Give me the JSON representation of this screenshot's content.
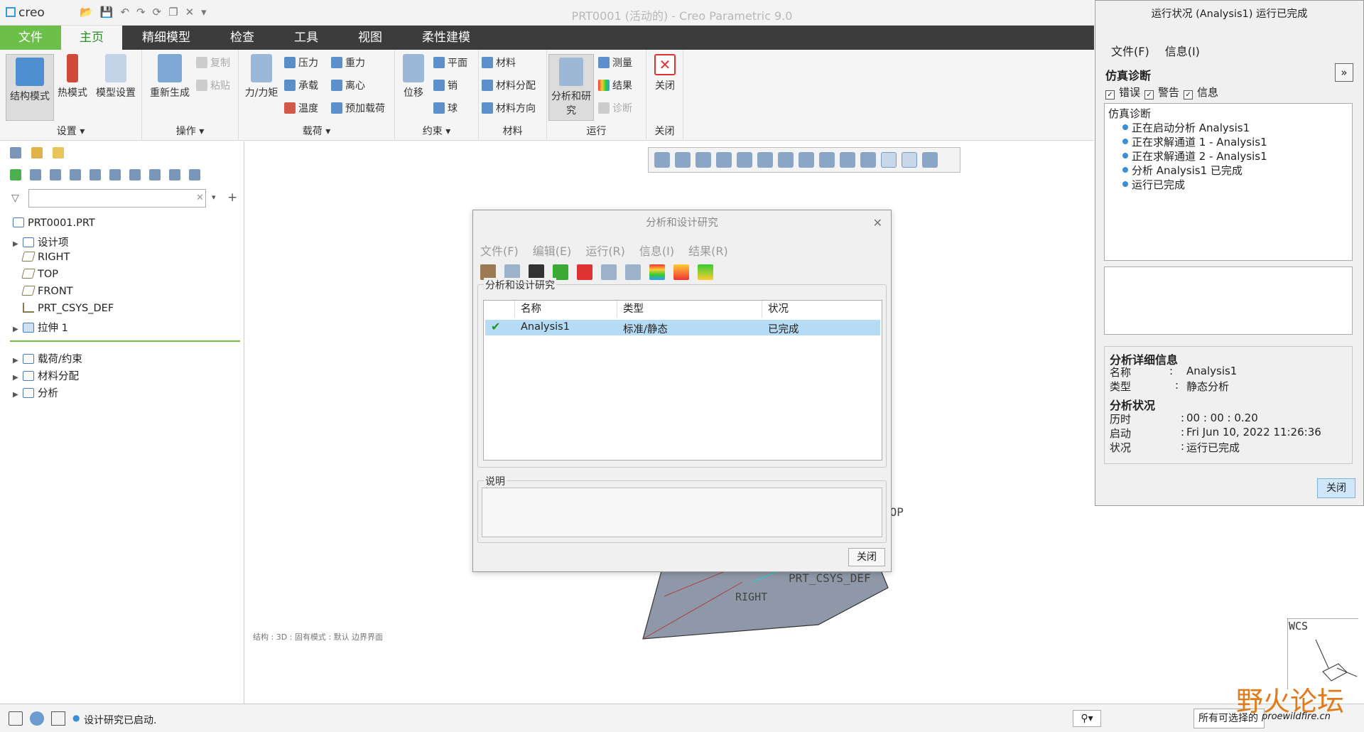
{
  "app": {
    "logo": "creo",
    "title": "PRT0001 (活动的) - Creo Parametric 9.0",
    "menu_tabs": [
      "文件",
      "主页",
      "精细模型",
      "检查",
      "工具",
      "视图",
      "柔性建模"
    ]
  },
  "ribbon": {
    "groups": [
      {
        "label": "设置",
        "buttons": [
          "结构模式",
          "热模式",
          "模型设置"
        ]
      },
      {
        "label": "操作",
        "buttons": [
          "重新生成",
          "复制",
          "粘贴"
        ]
      },
      {
        "label": "载荷",
        "buttons": [
          "力/力矩",
          "压力",
          "承载",
          "温度",
          "重力",
          "离心",
          "预加载荷"
        ]
      },
      {
        "label": "约束",
        "buttons": [
          "位移",
          "平面",
          "销",
          "球"
        ]
      },
      {
        "label": "材料",
        "buttons": [
          "材料",
          "材料分配",
          "材料方向"
        ]
      },
      {
        "label": "运行",
        "buttons": [
          "分析和研究",
          "测量",
          "结果",
          "诊断"
        ]
      },
      {
        "label": "关闭",
        "buttons": [
          "关闭"
        ]
      }
    ]
  },
  "model_tree": {
    "items": [
      "PRT0001.PRT",
      "设计项",
      "RIGHT",
      "TOP",
      "FRONT",
      "PRT_CSYS_DEF",
      "拉伸 1",
      "载荷/约束",
      "材料分配",
      "分析"
    ]
  },
  "canvas": {
    "labels": [
      "TOP",
      "PRT_CSYS_DEF",
      "RIGHT",
      "WCS"
    ],
    "status_info": "结构  :  3D  :  固有模式  :  默认  边界界面"
  },
  "analysis_dialog": {
    "title": "分析和设计研究",
    "menu": [
      "文件(F)",
      "编辑(E)",
      "运行(R)",
      "信息(I)",
      "结果(R)"
    ],
    "section_label": "分析和设计研究",
    "columns": [
      "名称",
      "类型",
      "状况"
    ],
    "rows": [
      {
        "name": "Analysis1",
        "type": "标准/静态",
        "status": "已完成"
      }
    ],
    "desc_label": "说明",
    "close_label": "关闭"
  },
  "run_status": {
    "title": "运行状况 (Analysis1) 运行已完成",
    "menu": [
      "文件(F)",
      "信息(I)"
    ],
    "diag_header": "仿真诊断",
    "checks": [
      "错误",
      "警告",
      "信息"
    ],
    "log_root": "仿真诊断",
    "log": [
      "正在启动分析 Analysis1",
      "正在求解通道 1 - Analysis1",
      "正在求解通道 2 - Analysis1",
      "分析 Analysis1 已完成",
      "运行已完成"
    ],
    "detail_header": "分析详细信息",
    "name_key": "名称",
    "name_val": "Analysis1",
    "type_key": "类型",
    "type_val": "静态分析",
    "status_header": "分析状况",
    "elapsed_key": "历时",
    "elapsed_val": "00 : 00 : 0.20",
    "start_key": "启动",
    "start_val": "Fri Jun 10, 2022   11:26:36",
    "state_key": "状况",
    "state_val": "运行已完成",
    "close_label": "关闭"
  },
  "statusbar": {
    "message": "设计研究已启动.",
    "selection": "所有可选择的"
  },
  "watermark": {
    "text": "野火论坛",
    "url": "proewildfire.cn"
  }
}
